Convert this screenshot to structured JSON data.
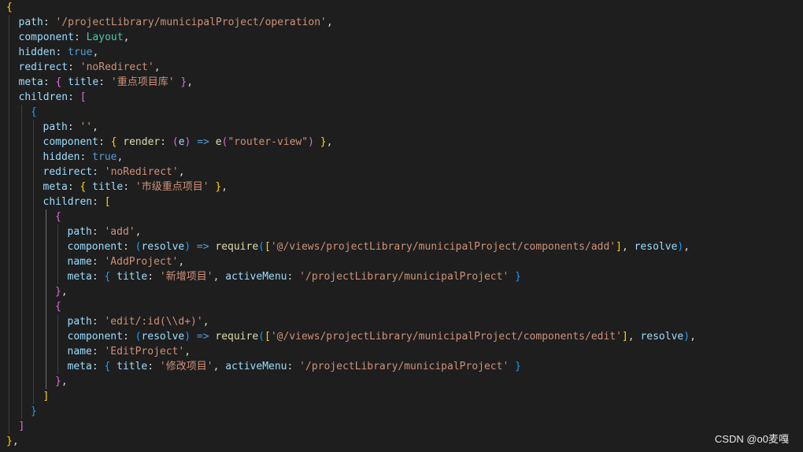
{
  "watermark": "CSDN @o0麦嘎",
  "colors": {
    "background": "#1e1e1e",
    "key": "#9cdcfe",
    "string": "#ce9178",
    "keyword": "#569cd6",
    "function": "#dcdcaa",
    "type": "#4ec9b0",
    "bracket_level1": "#ffd700",
    "bracket_level2": "#da70d6",
    "bracket_level3": "#179fff"
  },
  "code_lines": [
    [
      [
        "br1",
        "{"
      ]
    ],
    [
      [
        "k",
        "path"
      ],
      [
        "p",
        ": "
      ],
      [
        "s",
        "'/projectLibrary/municipalProject/operation'"
      ],
      [
        "p",
        ","
      ]
    ],
    [
      [
        "k",
        "component"
      ],
      [
        "p",
        ": "
      ],
      [
        "t",
        "Layout"
      ],
      [
        "p",
        ","
      ]
    ],
    [
      [
        "k",
        "hidden"
      ],
      [
        "p",
        ": "
      ],
      [
        "b",
        "true"
      ],
      [
        "p",
        ","
      ]
    ],
    [
      [
        "k",
        "redirect"
      ],
      [
        "p",
        ": "
      ],
      [
        "s",
        "'noRedirect'"
      ],
      [
        "p",
        ","
      ]
    ],
    [
      [
        "k",
        "meta"
      ],
      [
        "p",
        ": "
      ],
      [
        "br2",
        "{"
      ],
      [
        "p",
        " "
      ],
      [
        "k",
        "title"
      ],
      [
        "p",
        ": "
      ],
      [
        "s",
        "'重点项目库'"
      ],
      [
        "p",
        " "
      ],
      [
        "br2",
        "}"
      ],
      [
        "p",
        ","
      ]
    ],
    [
      [
        "k",
        "children"
      ],
      [
        "p",
        ": "
      ],
      [
        "br2",
        "["
      ]
    ],
    [
      [
        "br3",
        "{"
      ]
    ],
    [
      [
        "k",
        "path"
      ],
      [
        "p",
        ": "
      ],
      [
        "s",
        "''"
      ],
      [
        "p",
        ","
      ]
    ],
    [
      [
        "k",
        "component"
      ],
      [
        "p",
        ": "
      ],
      [
        "br1",
        "{"
      ],
      [
        "p",
        " "
      ],
      [
        "fn",
        "render"
      ],
      [
        "p",
        ": "
      ],
      [
        "br2",
        "("
      ],
      [
        "v",
        "e"
      ],
      [
        "br2",
        ")"
      ],
      [
        "p",
        " "
      ],
      [
        "b",
        "=>"
      ],
      [
        "p",
        " "
      ],
      [
        "fn",
        "e"
      ],
      [
        "br2",
        "("
      ],
      [
        "s",
        "\"router-view\""
      ],
      [
        "br2",
        ")"
      ],
      [
        "p",
        " "
      ],
      [
        "br1",
        "}"
      ],
      [
        "p",
        ","
      ]
    ],
    [
      [
        "k",
        "hidden"
      ],
      [
        "p",
        ": "
      ],
      [
        "b",
        "true"
      ],
      [
        "p",
        ","
      ]
    ],
    [
      [
        "k",
        "redirect"
      ],
      [
        "p",
        ": "
      ],
      [
        "s",
        "'noRedirect'"
      ],
      [
        "p",
        ","
      ]
    ],
    [
      [
        "k",
        "meta"
      ],
      [
        "p",
        ": "
      ],
      [
        "br1",
        "{"
      ],
      [
        "p",
        " "
      ],
      [
        "k",
        "title"
      ],
      [
        "p",
        ": "
      ],
      [
        "s",
        "'市级重点项目'"
      ],
      [
        "p",
        " "
      ],
      [
        "br1",
        "}"
      ],
      [
        "p",
        ","
      ]
    ],
    [
      [
        "k",
        "children"
      ],
      [
        "p",
        ": "
      ],
      [
        "br1",
        "["
      ]
    ],
    [
      [
        "br2",
        "{"
      ]
    ],
    [
      [
        "k",
        "path"
      ],
      [
        "p",
        ": "
      ],
      [
        "s",
        "'add'"
      ],
      [
        "p",
        ","
      ]
    ],
    [
      [
        "k",
        "component"
      ],
      [
        "p",
        ": "
      ],
      [
        "br3",
        "("
      ],
      [
        "v",
        "resolve"
      ],
      [
        "br3",
        ")"
      ],
      [
        "p",
        " "
      ],
      [
        "b",
        "=>"
      ],
      [
        "p",
        " "
      ],
      [
        "fn",
        "require"
      ],
      [
        "br3",
        "("
      ],
      [
        "br1",
        "["
      ],
      [
        "s",
        "'@/views/projectLibrary/municipalProject/components/add'"
      ],
      [
        "br1",
        "]"
      ],
      [
        "p",
        ", "
      ],
      [
        "v",
        "resolve"
      ],
      [
        "br3",
        ")"
      ],
      [
        "p",
        ","
      ]
    ],
    [
      [
        "k",
        "name"
      ],
      [
        "p",
        ": "
      ],
      [
        "s",
        "'AddProject'"
      ],
      [
        "p",
        ","
      ]
    ],
    [
      [
        "k",
        "meta"
      ],
      [
        "p",
        ": "
      ],
      [
        "br3",
        "{"
      ],
      [
        "p",
        " "
      ],
      [
        "k",
        "title"
      ],
      [
        "p",
        ": "
      ],
      [
        "s",
        "'新增项目'"
      ],
      [
        "p",
        ", "
      ],
      [
        "k",
        "activeMenu"
      ],
      [
        "p",
        ": "
      ],
      [
        "s",
        "'/projectLibrary/municipalProject'"
      ],
      [
        "p",
        " "
      ],
      [
        "br3",
        "}"
      ]
    ],
    [
      [
        "br2",
        "}"
      ],
      [
        "p",
        ","
      ]
    ],
    [
      [
        "br2",
        "{"
      ]
    ],
    [
      [
        "k",
        "path"
      ],
      [
        "p",
        ": "
      ],
      [
        "s",
        "'edit/:id(\\\\d+)'"
      ],
      [
        "p",
        ","
      ]
    ],
    [
      [
        "k",
        "component"
      ],
      [
        "p",
        ": "
      ],
      [
        "br3",
        "("
      ],
      [
        "v",
        "resolve"
      ],
      [
        "br3",
        ")"
      ],
      [
        "p",
        " "
      ],
      [
        "b",
        "=>"
      ],
      [
        "p",
        " "
      ],
      [
        "fn",
        "require"
      ],
      [
        "br3",
        "("
      ],
      [
        "br1",
        "["
      ],
      [
        "s",
        "'@/views/projectLibrary/municipalProject/components/edit'"
      ],
      [
        "br1",
        "]"
      ],
      [
        "p",
        ", "
      ],
      [
        "v",
        "resolve"
      ],
      [
        "br3",
        ")"
      ],
      [
        "p",
        ","
      ]
    ],
    [
      [
        "k",
        "name"
      ],
      [
        "p",
        ": "
      ],
      [
        "s",
        "'EditProject'"
      ],
      [
        "p",
        ","
      ]
    ],
    [
      [
        "k",
        "meta"
      ],
      [
        "p",
        ": "
      ],
      [
        "br3",
        "{"
      ],
      [
        "p",
        " "
      ],
      [
        "k",
        "title"
      ],
      [
        "p",
        ": "
      ],
      [
        "s",
        "'修改项目'"
      ],
      [
        "p",
        ", "
      ],
      [
        "k",
        "activeMenu"
      ],
      [
        "p",
        ": "
      ],
      [
        "s",
        "'/projectLibrary/municipalProject'"
      ],
      [
        "p",
        " "
      ],
      [
        "br3",
        "}"
      ]
    ],
    [
      [
        "br2",
        "}"
      ],
      [
        "p",
        ","
      ]
    ],
    [
      [
        "br1",
        "]"
      ]
    ],
    [
      [
        "br3",
        "}"
      ]
    ],
    [
      [
        "br2",
        "]"
      ]
    ],
    [
      [
        "br1",
        "}"
      ],
      [
        "p",
        ","
      ]
    ]
  ]
}
